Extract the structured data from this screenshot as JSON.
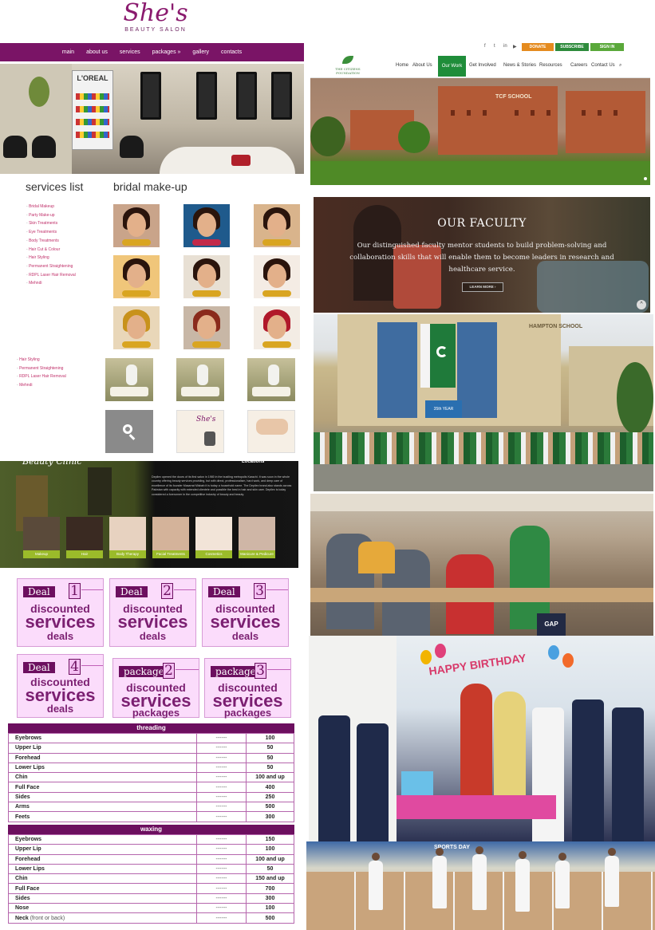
{
  "salon": {
    "logo": {
      "name": "She's",
      "tagline": "BEAUTY SALON"
    },
    "nav": [
      "main",
      "about us",
      "services",
      "packages »",
      "gallery",
      "contacts"
    ],
    "hero_brand": "L'OREAL",
    "services_title": "services list",
    "bridal_title": "bridal make-up",
    "services_list": [
      "Bridal Makeup",
      "Party Make-up",
      "Skin Treatments",
      "Eye Treatments",
      "Body Treatments",
      "Hair Cut & Colour",
      "Hair Styling",
      "Permanent Straightening",
      "RDPL Laser Hair Removal",
      "Mehndi"
    ],
    "services_list_2": [
      "Hair Styling",
      "Permanent Straightening",
      "RDPL Laser Hair Removal",
      "Mehndi"
    ],
    "brochure_logo": "She's",
    "clinic": {
      "title": "Beauty Clinic",
      "locations": "Locations",
      "description": "Depilex opened the doors of its first salon in 1980 in the bustling metropolis Karachi. It was soon in the whole country offering beauty services providing, but with direct, professionalism, hard work, and deep care of excellence of its founder Masarrat Misbah it is today a household name. The Depilex brand also stands across Pakistan with capacity with extended clientele and possible the best in hair and skin care. Depilex is today considered a forerunner in the competitive industry of beauty and beauty.",
      "tiles": [
        "Makeup",
        "Hair",
        "Body Therapy",
        "Facial Treatments",
        "Cosmetics",
        "Manicure & Pedicure"
      ]
    },
    "deals": [
      {
        "tag": "Deal",
        "num": "1",
        "line1": "discounted",
        "line2": "services",
        "line3": "deals"
      },
      {
        "tag": "Deal",
        "num": "2",
        "line1": "discounted",
        "line2": "services",
        "line3": "deals"
      },
      {
        "tag": "Deal",
        "num": "3",
        "line1": "discounted",
        "line2": "services",
        "line3": "deals"
      },
      {
        "tag": "Deal",
        "num": "4",
        "line1": "discounted",
        "line2": "services",
        "line3": "deals"
      },
      {
        "tag": "package",
        "num": "2",
        "line1": "discounted",
        "line2": "services",
        "line3": "packages"
      },
      {
        "tag": "package",
        "num": "3",
        "line1": "discounted",
        "line2": "services",
        "line3": "packages"
      }
    ],
    "threading": {
      "title": "threading",
      "rows": [
        {
          "name": "Eyebrows",
          "dash": "------",
          "price": "100"
        },
        {
          "name": "Upper Lip",
          "dash": "------",
          "price": "50"
        },
        {
          "name": "Forehead",
          "dash": "------",
          "price": "50"
        },
        {
          "name": "Lower Lips",
          "dash": "------",
          "price": "50"
        },
        {
          "name": "Chin",
          "dash": "------",
          "price": "100 and up"
        },
        {
          "name": "Full Face",
          "dash": "------",
          "price": "400"
        },
        {
          "name": "Sides",
          "dash": "------",
          "price": "250"
        },
        {
          "name": "Arms",
          "dash": "------",
          "price": "500"
        },
        {
          "name": "Feets",
          "dash": "------",
          "price": "300"
        }
      ]
    },
    "waxing": {
      "title": "waxing",
      "rows": [
        {
          "name": "Eyebrows",
          "dash": "------",
          "price": "150"
        },
        {
          "name": "Upper Lip",
          "dash": "------",
          "price": "100"
        },
        {
          "name": "Forehead",
          "dash": "------",
          "price": "100 and up"
        },
        {
          "name": "Lower Lips",
          "dash": "------",
          "price": "50"
        },
        {
          "name": "Chin",
          "dash": "------",
          "price": "150 and up"
        },
        {
          "name": "Full Face",
          "dash": "------",
          "price": "700"
        },
        {
          "name": "Sides",
          "dash": "------",
          "price": "300"
        },
        {
          "name": "Nose",
          "dash": "------",
          "price": "100"
        },
        {
          "name": "Neck",
          "note": "(front or back)",
          "dash": "------",
          "price": "500"
        }
      ]
    }
  },
  "tcf": {
    "social": [
      "f",
      "t",
      "in",
      "▶"
    ],
    "buttons": {
      "donate": "DONATE",
      "subscribe": "SUBSCRIBE",
      "sign_in": "SIGN IN"
    },
    "logo_text": "THE CITIZENS FOUNDATION",
    "nav": [
      "Home",
      "About Us",
      "Our Work",
      "Get Involved",
      "News & Stories",
      "Resources",
      "Careers",
      "Contact Us"
    ],
    "nav_search": "⌕",
    "hero_sign": "TCF SCHOOL",
    "faculty": {
      "title": "OUR FACULTY",
      "text": "Our distinguished faculty mentor students to build problem-solving and collaboration skills that will enable them to become leaders in research and healthcare service.",
      "cta": "LEARN MORE ›",
      "scroll_top": "^"
    },
    "flag_photo_sign": "HAMPTON SCHOOL",
    "banner_text": "35th YEAR",
    "birthday_banner": "HAPPY BIRTHDAY",
    "sports_banner": "SPORTS DAY",
    "classroom_bag": "GAP"
  },
  "colors": {
    "salon_purple": "#7a1466",
    "deal_pink": "#fbdcfb",
    "tcf_green": "#1f8d3a",
    "donate_orange": "#e58b1f",
    "subscribe_green": "#2e8b3c",
    "signin_green": "#5aa83a"
  }
}
